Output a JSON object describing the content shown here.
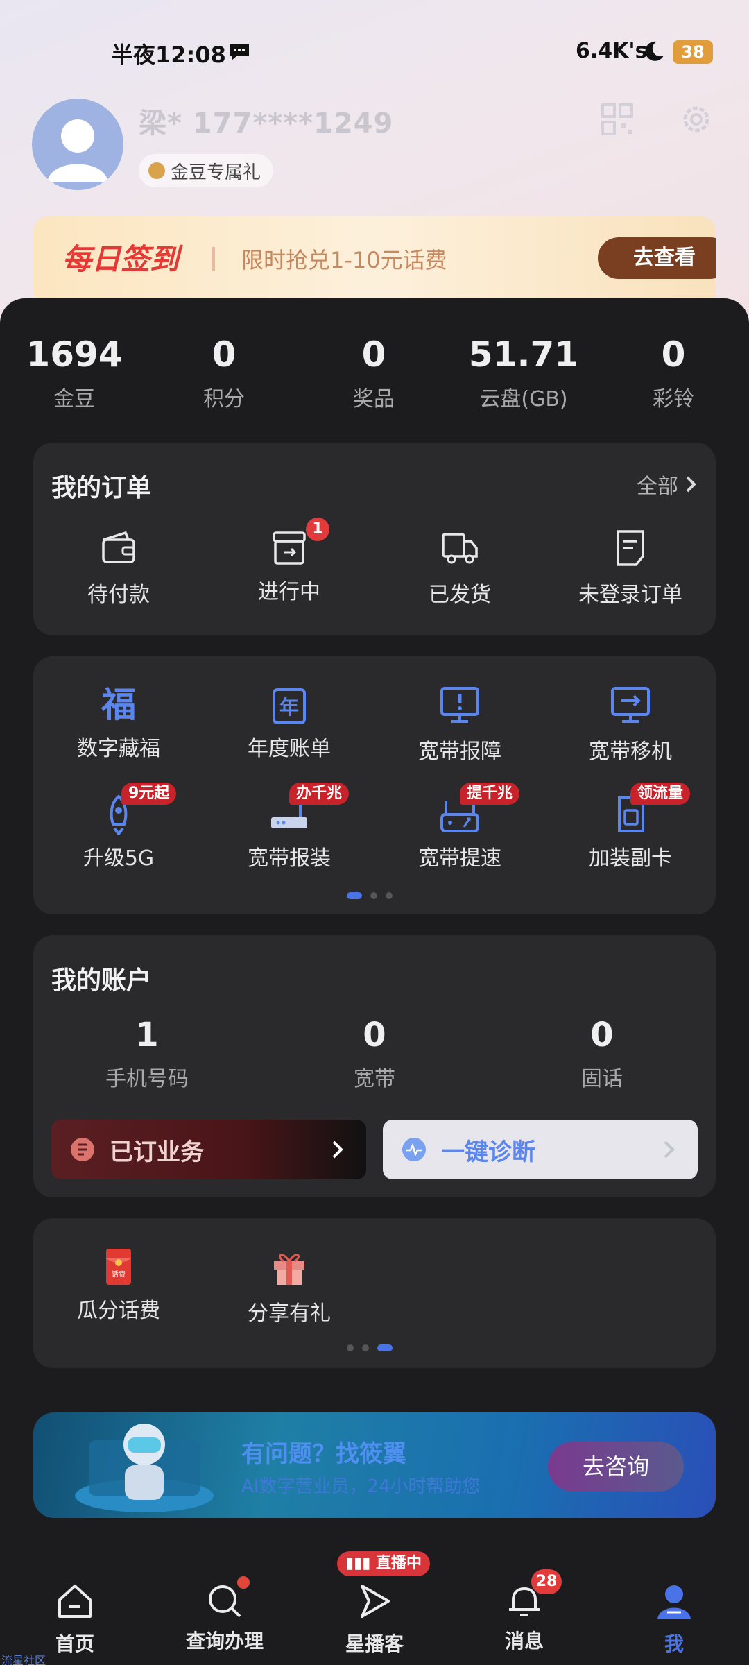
{
  "status": {
    "time": "半夜12:08",
    "speed": "6.4K's",
    "battery": "38"
  },
  "profile": {
    "name": "梁* 177****1249",
    "bean_chip": "金豆专属礼"
  },
  "checkin": {
    "title": "每日签到",
    "text": "限时抢兑1-10元话费",
    "button": "去查看"
  },
  "stats": [
    {
      "value": "1694",
      "label": "金豆"
    },
    {
      "value": "0",
      "label": "积分"
    },
    {
      "value": "0",
      "label": "奖品"
    },
    {
      "value": "51.71",
      "label": "云盘(GB)"
    },
    {
      "value": "0",
      "label": "彩铃"
    }
  ],
  "orders": {
    "title": "我的订单",
    "more": "全部",
    "items": [
      {
        "label": "待付款",
        "icon": "wallet-icon"
      },
      {
        "label": "进行中",
        "icon": "in-progress-icon",
        "badge": "1"
      },
      {
        "label": "已发货",
        "icon": "truck-icon"
      },
      {
        "label": "未登录订单",
        "icon": "document-icon"
      }
    ]
  },
  "services": {
    "row1": [
      {
        "label": "数字藏福",
        "icon_text": "福"
      },
      {
        "label": "年度账单",
        "icon_text": "年"
      },
      {
        "label": "宽带报障",
        "icon": "monitor-alert-icon"
      },
      {
        "label": "宽带移机",
        "icon": "monitor-move-icon"
      }
    ],
    "row2": [
      {
        "label": "升级5G",
        "tag": "9元起"
      },
      {
        "label": "宽带报装",
        "tag": "办千兆"
      },
      {
        "label": "宽带提速",
        "tag": "提千兆"
      },
      {
        "label": "加装副卡",
        "tag": "领流量"
      }
    ]
  },
  "account": {
    "title": "我的账户",
    "items": [
      {
        "value": "1",
        "label": "手机号码"
      },
      {
        "value": "0",
        "label": "宽带"
      },
      {
        "value": "0",
        "label": "固话"
      }
    ],
    "subscribed": "已订业务",
    "diagnose": "一键诊断"
  },
  "activities": [
    {
      "label": "瓜分话费",
      "icon_text": "话费"
    },
    {
      "label": "分享有礼"
    }
  ],
  "promo": {
    "title": "有问题？找筱翼",
    "subtitle": "AI数字营业员，24小时帮助您",
    "button": "去咨询"
  },
  "tabs": [
    {
      "label": "首页"
    },
    {
      "label": "查询办理"
    },
    {
      "label": "星播客"
    },
    {
      "label": "消息",
      "badge": "28"
    },
    {
      "label": "我"
    }
  ],
  "live_tag": "直播中",
  "watermark": "流星社区",
  "colors": {
    "accent": "#4a73e8",
    "badge_red": "#e23b3b",
    "banner_btn": "#7a3e20"
  }
}
